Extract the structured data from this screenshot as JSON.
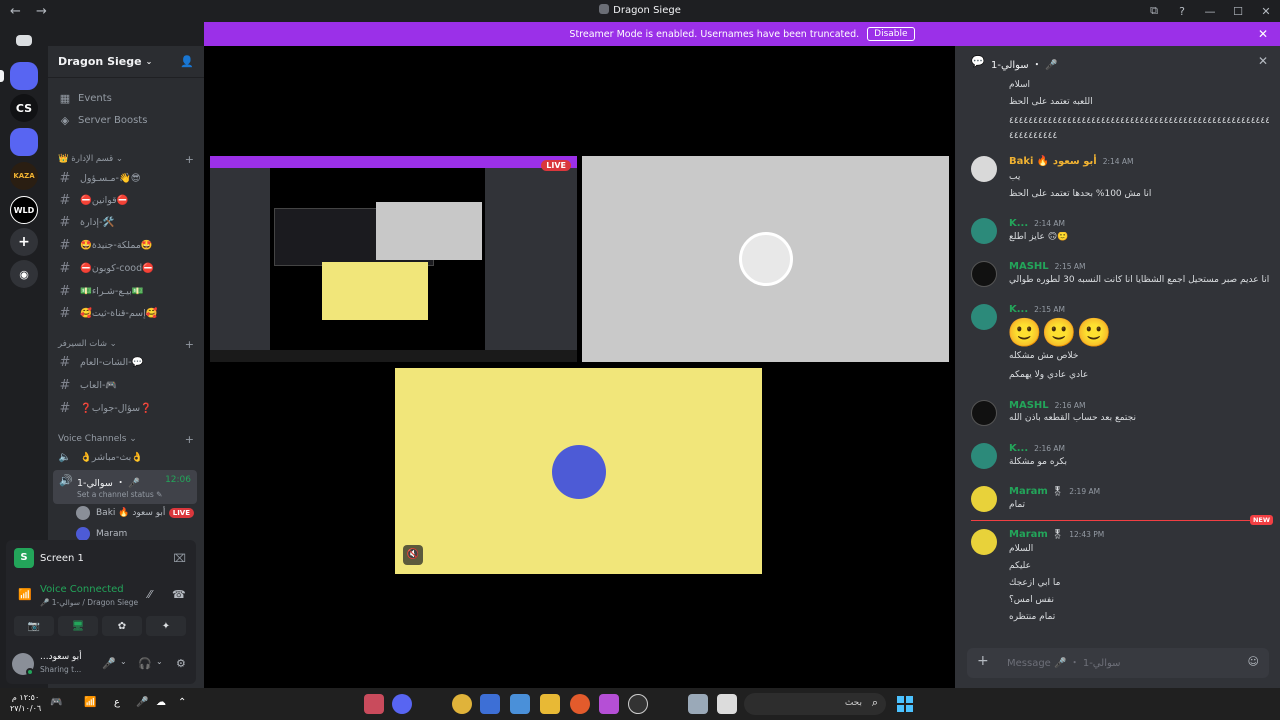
{
  "window": {
    "title": "Dragon Siege",
    "back": "←",
    "forward": "→",
    "controls": [
      "⧉",
      "?",
      "—",
      "☐",
      "✕"
    ]
  },
  "banner": {
    "text": "Streamer Mode is enabled. Usernames have been truncated.",
    "button": "Disable",
    "close": "✕"
  },
  "rail": {
    "servers": [
      {
        "label": "",
        "color": "#5865f2"
      },
      {
        "label": "",
        "color": "#7a6bd6"
      },
      {
        "label": "CS",
        "color": "#111214"
      },
      {
        "label": "",
        "color": "#5865f2"
      },
      {
        "label": "KAZA",
        "color": "#2a1e12"
      },
      {
        "label": "WLD",
        "color": "#000000"
      },
      {
        "label": "+",
        "color": "#313338"
      },
      {
        "label": "◉",
        "color": "#313338"
      }
    ]
  },
  "sidebar": {
    "server_name": "Dragon Siege",
    "shortcuts": [
      {
        "icon": "▦",
        "label": "Events"
      },
      {
        "icon": "◈",
        "label": "Server Boosts"
      }
    ],
    "categories": [
      {
        "label": "👑 قسم الإدارة ⌄"
      },
      {
        "label": "شات السيرفر ⌄"
      },
      {
        "label": "Voice Channels ⌄"
      }
    ],
    "admin_channels": [
      "مـسـؤول-👋😎",
      "⛔قوانين⛔",
      "إدارة-🛠️",
      "🤩مملكة-جنيدة🤩",
      "⛔كوبون-cood⛔",
      "💵بيـع-شـراء💵",
      "🥰إسم-قناة-ثيت🥰"
    ],
    "chat_channels": [
      "الشات-العام-💬",
      "العاب-🎮",
      "❓سؤال-جواب❓"
    ],
    "voice_channels": [
      {
        "name": "👌بث-مباشر👌"
      },
      {
        "name": "سوالي-1 ・ 🎤",
        "time": "12:06",
        "status": "Set a channel status ✎"
      }
    ],
    "voice_users": [
      {
        "name": "Baki 🔥 أبو سعود",
        "live": "LIVE",
        "color": "#8a8f98"
      },
      {
        "name": "Maram",
        "color": "#4d5bd6"
      }
    ]
  },
  "screen_share_panel": {
    "label": "Screen 1",
    "close": "⌧"
  },
  "voice_panel": {
    "status": "Voice Connected",
    "sub": "🎤 سوالي-1 / Dragon Siege",
    "buttons": [
      "📷",
      "🖥",
      "✿",
      "✦"
    ]
  },
  "user_panel": {
    "name": "...أبو سعود",
    "status": "Sharing t...",
    "controls": [
      "🎤",
      "⌄",
      "🎧",
      "⌄",
      "⚙"
    ]
  },
  "stage": {
    "live_label": "LIVE",
    "mute_icon": "🔇"
  },
  "chat": {
    "header_title": "سوالي-1 ・ 🎤",
    "messages": [
      {
        "lines": [
          "اسلام",
          "اللعبه تعتمد على الحظ",
          "٤٤٤٤٤٤٤٤٤٤٤٤٤٤٤٤٤٤٤٤٤٤٤٤٤٤٤٤٤٤٤٤٤٤٤٤٤٤٤٤٤٤٤٤٤٤٤٤٤٤٤٤٤٤٤",
          "٤٤٤٤٤٤٤٤٤٤"
        ]
      },
      {
        "name": "Baki 🔥 أبو سعود",
        "time": "2:14 AM",
        "color": "#f0b232",
        "lines": [
          "يب",
          "انا مش 100% بحدها تعتمد على الحظ"
        ]
      },
      {
        "name": "K...",
        "time": "2:14 AM",
        "color": "#23a55a",
        "lines": [
          "عايز اطلع 🙃🙂"
        ]
      },
      {
        "name": "MASHL",
        "time": "2:15 AM",
        "color": "#23a55a",
        "lines": [
          "انا عديم صبر مستحيل اجمع الشظايا انا كانت النسبه 30 لطوره طوالي"
        ]
      },
      {
        "name": "K...",
        "time": "2:15 AM",
        "color": "#23a55a",
        "emoji": "🙂🙂🙂",
        "lines": [
          "خلاص مش مشكله",
          "عادي عادي ولا يهمكم"
        ]
      },
      {
        "name": "MASHL",
        "time": "2:16 AM",
        "color": "#23a55a",
        "lines": [
          "نجتمع بعد حساب القطعه باذن الله"
        ]
      },
      {
        "name": "K...",
        "time": "2:16 AM",
        "color": "#23a55a",
        "lines": [
          "بكره مو مشكلة"
        ]
      },
      {
        "name": "Maram",
        "badge": "🎖",
        "time": "2:19 AM",
        "color": "#23a55a",
        "lines": [
          "تمام"
        ]
      },
      {
        "name": "Maram",
        "badge": "🎖",
        "time": "12:43 PM",
        "color": "#23a55a",
        "lines": [
          "السلام",
          "عليكم",
          "ما ابي ازعجك",
          "نفس امس؟",
          "تمام منتظره"
        ]
      }
    ],
    "new_label": "NEW",
    "composer_placeholder": "Message 🎤 ・ سوالي-1"
  },
  "taskbar": {
    "clock_time": "١٢:٥٠ م",
    "clock_date": "٢٧/١٠/٠٦",
    "tray": [
      "🎮",
      "📶",
      "ع",
      "🎤",
      "☁",
      "⌃"
    ],
    "search_text": "بحث"
  }
}
